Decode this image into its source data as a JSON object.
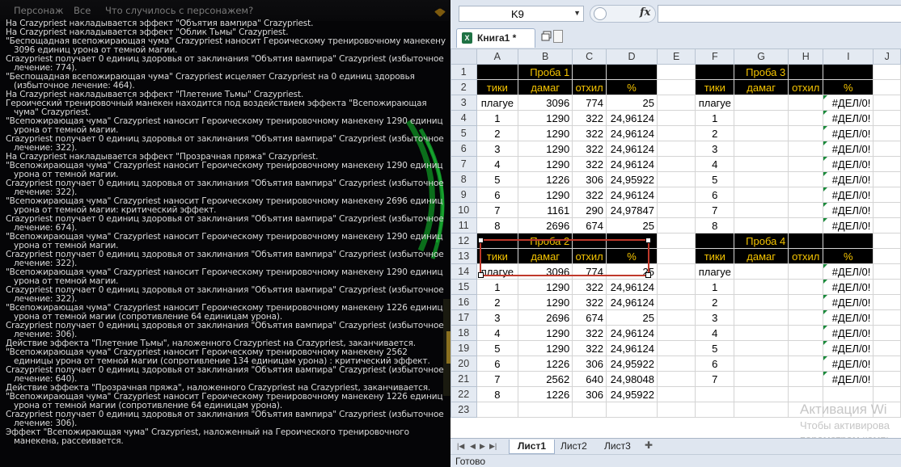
{
  "game": {
    "tabs": [
      "Персонаж",
      "Все",
      "Что случилось с персонажем?"
    ],
    "log": [
      "На Crazypriest накладывается эффект \"Объятия вампира\" Crazypriest.",
      "На Crazypriest накладывается эффект \"Облик Тьмы\" Crazypriest.",
      "\"Беспощадная всепожирающая чума\" Crazypriest наносит Героическому тренировочному манекену 3096 единиц урона от темной магии.",
      "Crazypriest получает 0 единиц здоровья от заклинания \"Объятия вампира\" Crazypriest (избыточное лечение: 774).",
      "\"Беспощадная всепожирающая чума\" Crazypriest исцеляет Crazypriest на 0 единиц здоровья (избыточное лечение: 464).",
      "На Crazypriest накладывается эффект \"Плетение Тьмы\" Crazypriest.",
      "Героический тренировочный манекен находится под воздействием эффекта \"Всепожирающая чума\" Crazypriest.",
      "\"Всепожирающая чума\" Crazypriest наносит Героическому тренировочному манекену 1290 единиц урона от темной магии.",
      "Crazypriest получает 0 единиц здоровья от заклинания \"Объятия вампира\" Crazypriest (избыточное лечение: 322).",
      "На Crazypriest накладывается эффект \"Прозрачная пряжа\" Crazypriest.",
      "\"Всепожирающая чума\" Crazypriest наносит Героическому тренировочному манекену 1290 единиц урона от темной магии.",
      "Crazypriest получает 0 единиц здоровья от заклинания \"Объятия вампира\" Crazypriest (избыточное лечение: 322).",
      "\"Всепожирающая чума\" Crazypriest наносит Героическому тренировочному манекену 2696 единиц урона от темной магии: критический эффект.",
      "Crazypriest получает 0 единиц здоровья от заклинания \"Объятия вампира\" Crazypriest (избыточное лечение: 674).",
      "\"Всепожирающая чума\" Crazypriest наносит Героическому тренировочному манекену 1290 единиц урона от темной магии.",
      "Crazypriest получает 0 единиц здоровья от заклинания \"Объятия вампира\" Crazypriest (избыточное лечение: 322).",
      "\"Всепожирающая чума\" Crazypriest наносит Героическому тренировочному манекену 1290 единиц урона от темной магии.",
      "Crazypriest получает 0 единиц здоровья от заклинания \"Объятия вампира\" Crazypriest (избыточное лечение: 322).",
      "\"Всепожирающая чума\" Crazypriest наносит Героическому тренировочному манекену 1226 единиц урона от темной магии (сопротивление 64 единицам урона).",
      "Crazypriest получает 0 единиц здоровья от заклинания \"Объятия вампира\" Crazypriest (избыточное лечение: 306).",
      "Действие эффекта \"Плетение Тьмы\", наложенного Crazypriest на Crazypriest, заканчивается.",
      "\"Всепожирающая чума\" Crazypriest наносит Героическому тренировочному манекену 2562 единицы урона от темной магии (сопротивление 134 единицам урона) : критический эффект.",
      "Crazypriest получает 0 единиц здоровья от заклинания \"Объятия вампира\" Crazypriest (избыточное лечение: 640).",
      "Действие эффекта \"Прозрачная пряжа\", наложенного Crazypriest на Crazypriest, заканчивается.",
      "\"Всепожирающая чума\" Crazypriest наносит Героическому тренировочному манекену 1226 единиц урона от темной магии (сопротивление 64 единицам урона).",
      "Crazypriest получает 0 единиц здоровья от заклинания \"Объятия вампира\" Crazypriest (избыточное лечение: 306).",
      "Эффект \"Всепожирающая чума\" Crazypriest, наложенный на Героического тренировочного манекена, рассеивается."
    ]
  },
  "excel": {
    "name_box": "K9",
    "fx_label": "fx",
    "workbook_title": "Книга1 *",
    "columns": [
      "A",
      "B",
      "C",
      "D",
      "E",
      "F",
      "G",
      "H",
      "I",
      "J"
    ],
    "rows": [
      [
        "",
        "Проба 1",
        "",
        "",
        "",
        "",
        "Проба 3",
        "",
        ""
      ],
      [
        "тики",
        "дамаг",
        "отхил",
        "%",
        "",
        "тики",
        "дамаг",
        "отхил",
        "%"
      ],
      [
        "плагуе",
        "3096",
        "774",
        "25",
        "",
        "плагуе",
        "",
        "",
        "#ДЕЛ/0!"
      ],
      [
        "1",
        "1290",
        "322",
        "24,96124",
        "",
        "1",
        "",
        "",
        "#ДЕЛ/0!"
      ],
      [
        "2",
        "1290",
        "322",
        "24,96124",
        "",
        "2",
        "",
        "",
        "#ДЕЛ/0!"
      ],
      [
        "3",
        "1290",
        "322",
        "24,96124",
        "",
        "3",
        "",
        "",
        "#ДЕЛ/0!"
      ],
      [
        "4",
        "1290",
        "322",
        "24,96124",
        "",
        "4",
        "",
        "",
        "#ДЕЛ/0!"
      ],
      [
        "5",
        "1226",
        "306",
        "24,95922",
        "",
        "5",
        "",
        "",
        "#ДЕЛ/0!"
      ],
      [
        "6",
        "1290",
        "322",
        "24,96124",
        "",
        "6",
        "",
        "",
        "#ДЕЛ/0!"
      ],
      [
        "7",
        "1161",
        "290",
        "24,97847",
        "",
        "7",
        "",
        "",
        "#ДЕЛ/0!"
      ],
      [
        "8",
        "2696",
        "674",
        "25",
        "",
        "8",
        "",
        "",
        "#ДЕЛ/0!"
      ],
      [
        "",
        "Проба 2",
        "",
        "",
        "",
        "",
        "Проба 4",
        "",
        ""
      ],
      [
        "тики",
        "дамаг",
        "отхил",
        "%",
        "",
        "тики",
        "дамаг",
        "отхил",
        "%"
      ],
      [
        "плагуе",
        "3096",
        "774",
        "25",
        "",
        "плагуе",
        "",
        "",
        "#ДЕЛ/0!"
      ],
      [
        "1",
        "1290",
        "322",
        "24,96124",
        "",
        "1",
        "",
        "",
        "#ДЕЛ/0!"
      ],
      [
        "2",
        "1290",
        "322",
        "24,96124",
        "",
        "2",
        "",
        "",
        "#ДЕЛ/0!"
      ],
      [
        "3",
        "2696",
        "674",
        "25",
        "",
        "3",
        "",
        "",
        "#ДЕЛ/0!"
      ],
      [
        "4",
        "1290",
        "322",
        "24,96124",
        "",
        "4",
        "",
        "",
        "#ДЕЛ/0!"
      ],
      [
        "5",
        "1290",
        "322",
        "24,96124",
        "",
        "5",
        "",
        "",
        "#ДЕЛ/0!"
      ],
      [
        "6",
        "1226",
        "306",
        "24,95922",
        "",
        "6",
        "",
        "",
        "#ДЕЛ/0!"
      ],
      [
        "7",
        "2562",
        "640",
        "24,98048",
        "",
        "7",
        "",
        "",
        "#ДЕЛ/0!"
      ],
      [
        "8",
        "1226",
        "306",
        "24,95922",
        "",
        "",
        "",
        "",
        ""
      ],
      [
        "",
        "",
        "",
        "",
        "",
        "",
        "",
        "",
        ""
      ]
    ],
    "sheets": [
      "Лист1",
      "Лист2",
      "Лист3"
    ],
    "status": "Готово",
    "watermark": {
      "line1": "Активация Wi",
      "line2": "Чтобы активирова",
      "line3": "параметрам компь"
    },
    "colors": {
      "header_fill": "#000000",
      "header_text": "#f5c400",
      "selection": "#c0392b",
      "error_flag": "#1a8a3b"
    }
  }
}
